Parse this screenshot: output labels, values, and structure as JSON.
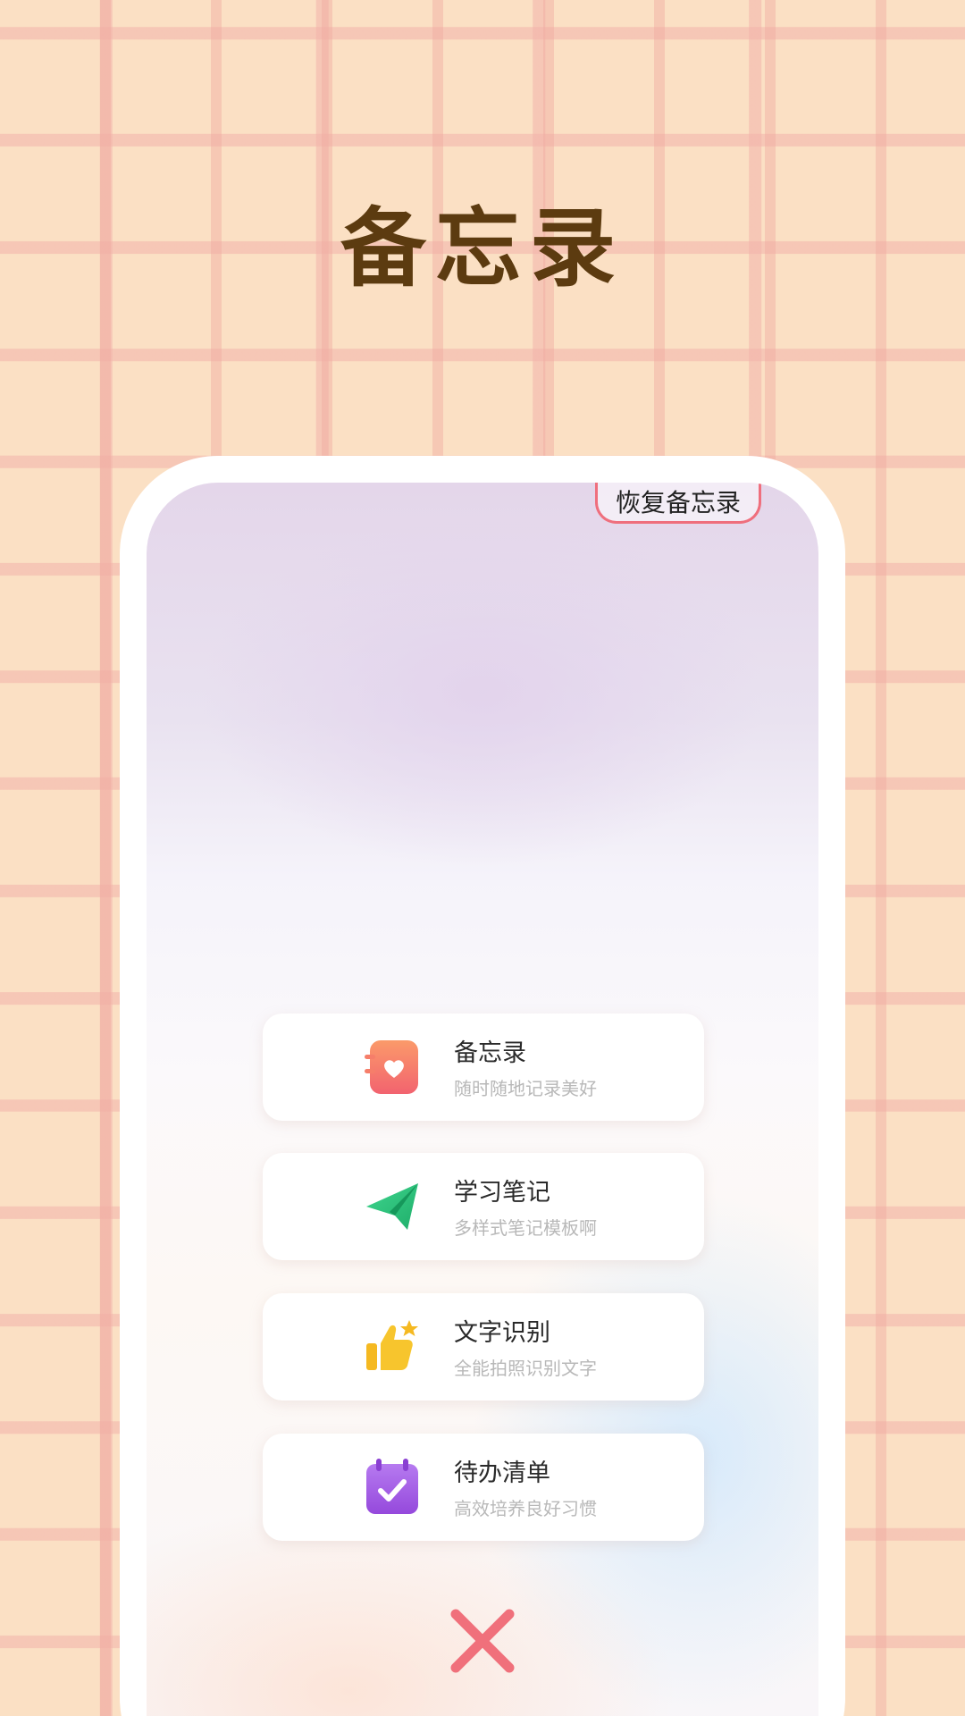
{
  "promo": {
    "headline": "备忘录"
  },
  "screen": {
    "restore_button_label": "恢复备忘录",
    "menu_items": [
      {
        "title": "备忘录",
        "subtitle": "随时随地记录美好",
        "icon": "notebook-heart-icon",
        "icon_color": "#f46b6e"
      },
      {
        "title": "学习笔记",
        "subtitle": "多样式笔记模板啊",
        "icon": "paper-plane-icon",
        "icon_color": "#2ec27e"
      },
      {
        "title": "文字识别",
        "subtitle": "全能拍照识别文字",
        "icon": "thumbs-up-star-icon",
        "icon_color": "#f5b921"
      },
      {
        "title": "待办清单",
        "subtitle": "高效培养良好习惯",
        "icon": "calendar-check-icon",
        "icon_color": "#a45ee5"
      }
    ],
    "close_icon": "close-icon",
    "close_color": "#f0707b"
  }
}
